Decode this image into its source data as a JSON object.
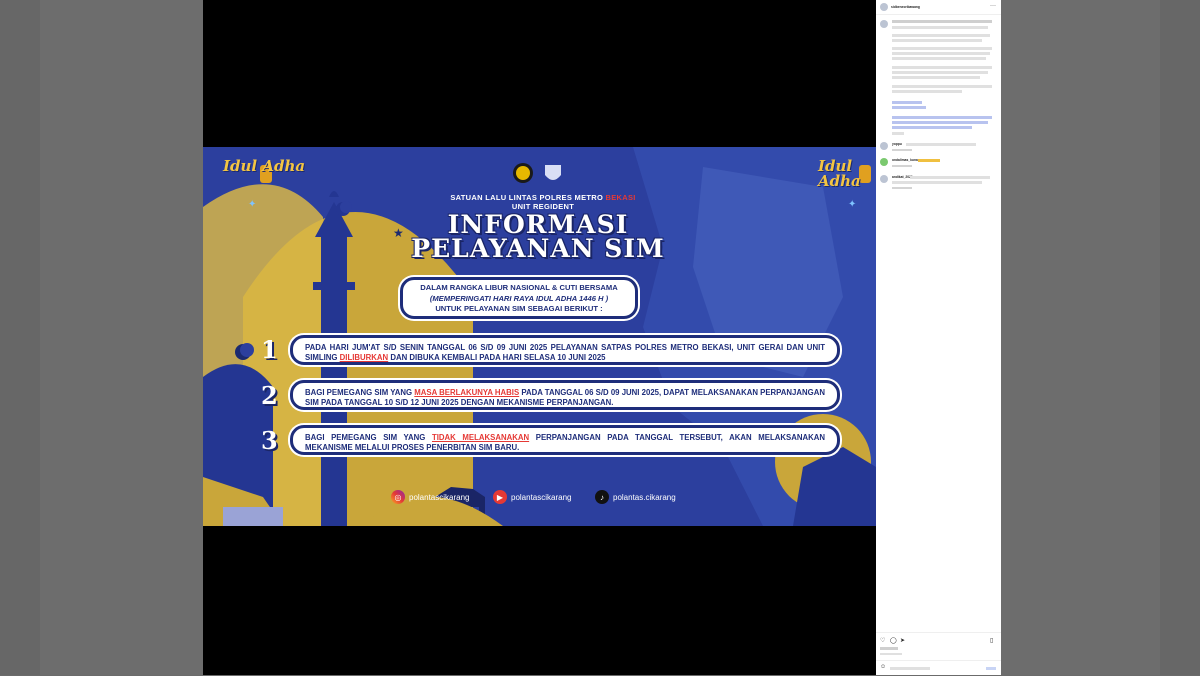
{
  "post": {
    "idul_adha": "Idul Adha",
    "org_line1": "SATUAN LALU LINTAS POLRES METRO",
    "org_red": "BEKASI",
    "org_line2": "UNIT REGIDENT",
    "title_line1": "INFORMASI",
    "title_line2": "PELAYANAN SIM",
    "intro_line1": "DALAM RANGKA LIBUR NASIONAL & CUTI BERSAMA",
    "intro_line2": "(MEMPERINGATI HARI RAYA IDUL ADHA 1446 H )",
    "intro_line3": "UNTUK PELAYANAN SIM SEBAGAI BERIKUT :",
    "items": [
      {
        "num": "1",
        "pre": "PADA HARI JUM'AT S/D SENIN TANGGAL 06 S/D 09 JUNI 2025 PELAYANAN SATPAS POLRES METRO BEKASI, UNIT GERAI DAN UNIT SIMLING ",
        "red": "DILIBURKAN",
        "post": " DAN DIBUKA KEMBALI PADA HARI SELASA 10 JUNI 2025"
      },
      {
        "num": "2",
        "pre": "BAGI PEMEGANG SIM YANG ",
        "red": "MASA BERLAKUNYA HABIS",
        "post": " PADA TANGGAL 06 S/D 09 JUNI 2025, DAPAT MELAKSANAKAN PERPANJANGAN SIM PADA TANGGAL 10 S/D 12 JUNI 2025 DENGAN MEKANISME PERPANJANGAN."
      },
      {
        "num": "3",
        "pre": "BAGI PEMEGANG SIM YANG ",
        "red": "TIDAK MELAKSANAKAN",
        "post": " PERPANJANGAN PADA TANGGAL TERSEBUT, AKAN MELAKSANAKAN MEKANISME MELALUI PROSES PENERBITAN SIM BARU."
      }
    ],
    "socials": {
      "instagram": "polantascikarang",
      "youtube": "polantascikarang",
      "tiktok": "polantas.cikarang"
    }
  },
  "sidebar": {
    "header_user": "sidbeneoribawang",
    "comments": [
      {
        "user": "yoppu",
        "text": "..."
      },
      {
        "user": "ondalimas_kunar",
        "text": "..."
      },
      {
        "user": "andikat_2020",
        "text": "..."
      }
    ]
  },
  "colors": {
    "slide_blue": "#2c3f9e",
    "gold": "#c9a63a",
    "navy": "#1e2d7a",
    "red": "#e53935"
  }
}
